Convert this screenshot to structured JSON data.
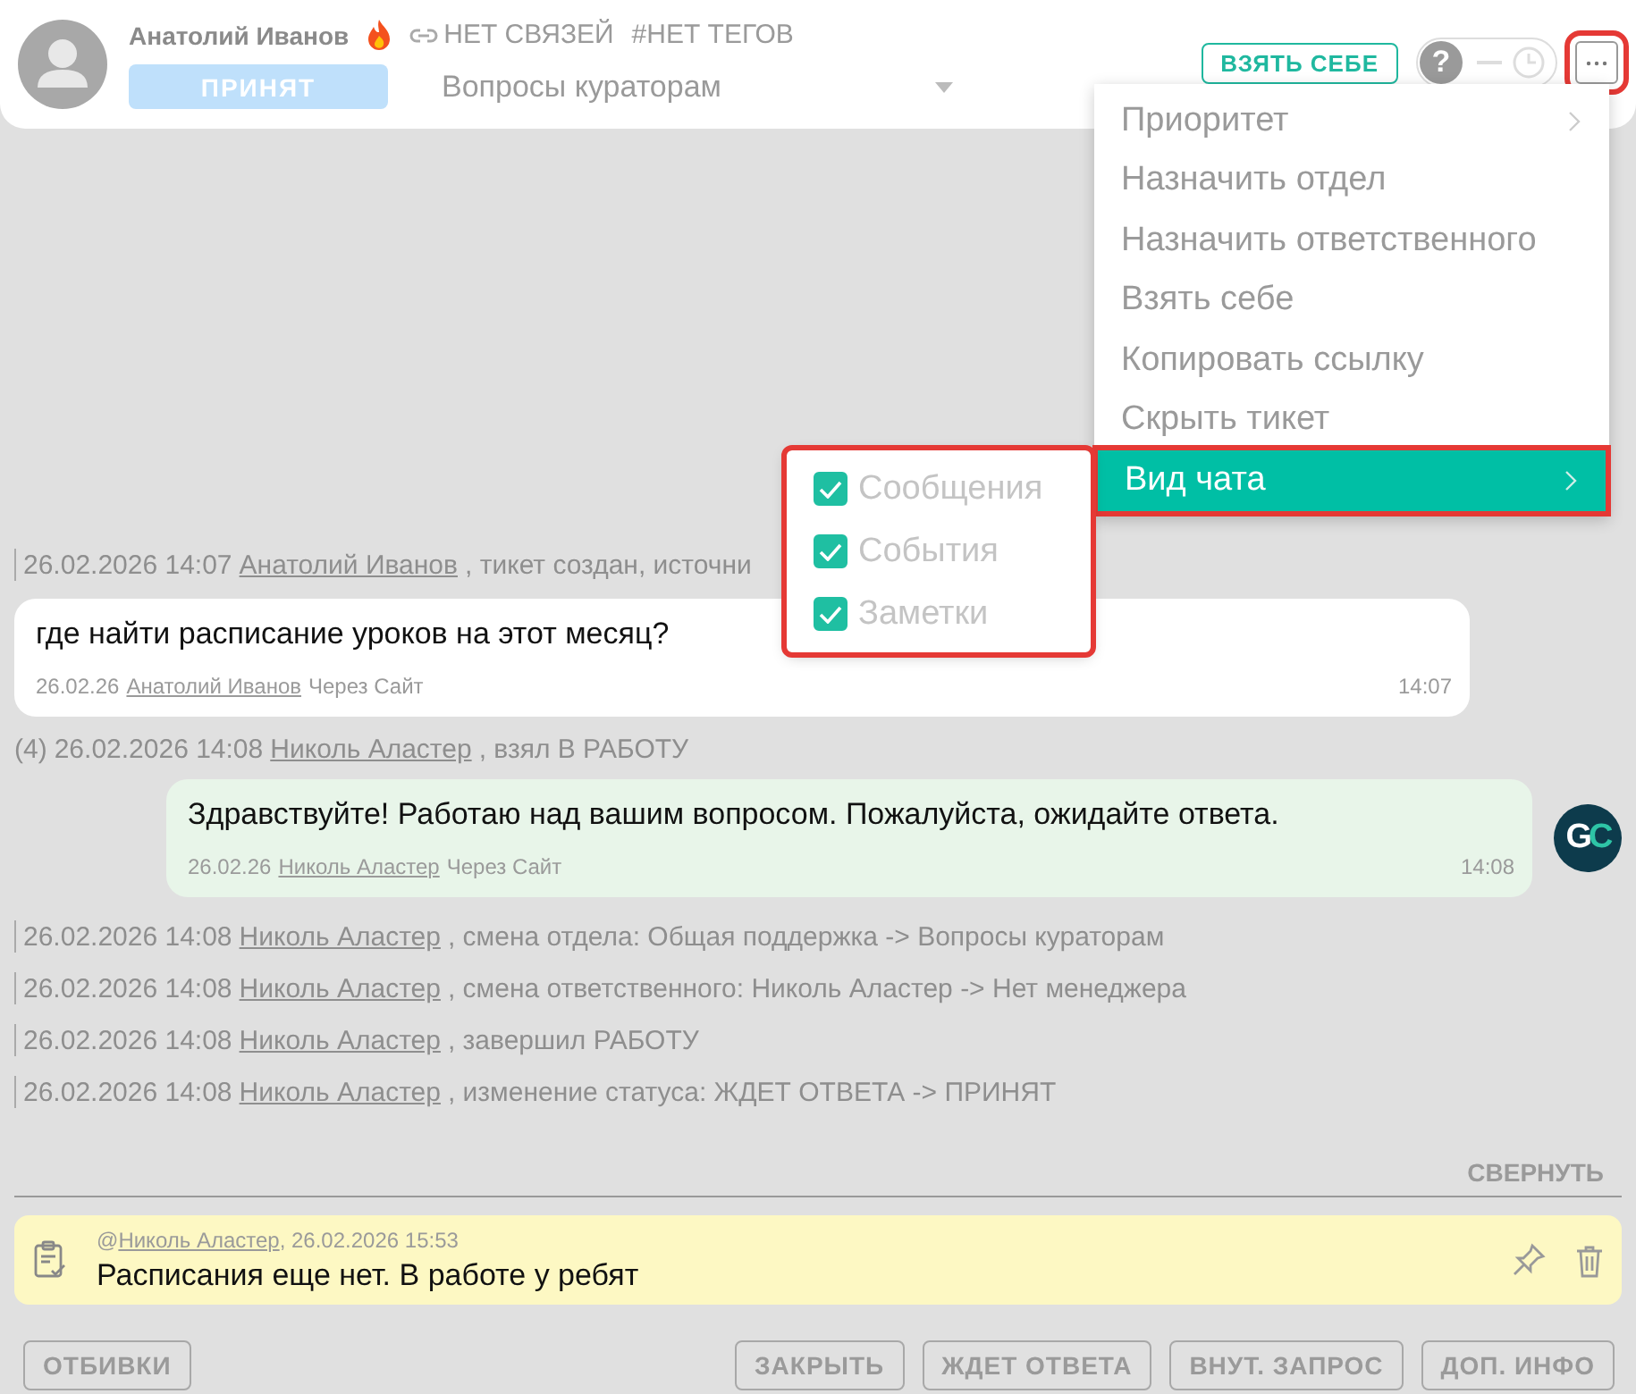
{
  "header": {
    "name": "Анатолий Иванов",
    "links": "НЕТ СВЯЗЕЙ",
    "tags": "#НЕТ ТЕГОВ",
    "status": "ПРИНЯТ",
    "department": "Вопросы кураторам",
    "take_button": "ВЗЯТЬ СЕБЕ",
    "help_label": "?"
  },
  "menu": {
    "items": [
      {
        "label": "Приоритет",
        "submenu": true,
        "selected": false
      },
      {
        "label": "Назначить отдел",
        "submenu": false,
        "selected": false
      },
      {
        "label": "Назначить ответственного",
        "submenu": false,
        "selected": false
      },
      {
        "label": "Взять себе",
        "submenu": false,
        "selected": false
      },
      {
        "label": "Копировать ссылку",
        "submenu": false,
        "selected": false
      },
      {
        "label": "Скрыть тикет",
        "submenu": false,
        "selected": false
      },
      {
        "label": "Вид чата",
        "submenu": true,
        "selected": true
      }
    ]
  },
  "submenu": {
    "items": [
      {
        "label": "Сообщения",
        "checked": true
      },
      {
        "label": "События",
        "checked": true
      },
      {
        "label": "Заметки",
        "checked": true
      }
    ]
  },
  "feed": [
    {
      "kind": "event",
      "datetime": "26.02.2026 14:07",
      "author": "Анатолий Иванов",
      "text": ", тикет создан, источни"
    },
    {
      "kind": "incoming",
      "text": "где найти расписание уроков на этот месяц?",
      "date": "26.02.26",
      "author": "Анатолий Иванов",
      "via": "Через Сайт",
      "time": "14:07"
    },
    {
      "kind": "event",
      "count": "(4)",
      "datetime": "26.02.2026 14:08",
      "author": "Николь Аластер",
      "text": ", взял В РАБОТУ"
    },
    {
      "kind": "outgoing",
      "text": "Здравствуйте! Работаю над вашим вопросом. Пожалуйста, ожидайте ответа.",
      "date": "26.02.26",
      "author": "Николь Аластер",
      "via": "Через Сайт",
      "time": "14:08",
      "avatar": "GC"
    },
    {
      "kind": "event",
      "datetime": "26.02.2026 14:08",
      "author": "Николь Аластер",
      "text": ", смена отдела: Общая поддержка -> Вопросы кураторам"
    },
    {
      "kind": "event",
      "datetime": "26.02.2026 14:08",
      "author": "Николь Аластер",
      "text": ", смена ответственного: Николь Аластер -> Нет менеджера"
    },
    {
      "kind": "event",
      "datetime": "26.02.2026 14:08",
      "author": "Николь Аластер",
      "text": ", завершил РАБОТУ"
    },
    {
      "kind": "event",
      "datetime": "26.02.2026 14:08",
      "author": "Николь Аластер",
      "text": ", изменение статуса: ЖДЕТ ОТВЕТА -> ПРИНЯТ"
    }
  ],
  "collapse_button": "СВЕРНУТЬ",
  "note": {
    "mention": "@",
    "author": "Николь Аластер",
    "meta": ", 26.02.2026 15:53",
    "text": "Расписания еще нет. В работе у ребят"
  },
  "footer": {
    "left": [
      "ОТБИВКИ"
    ],
    "right": [
      "ЗАКРЫТЬ",
      "ЖДЕТ ОТВЕТА",
      "ВНУТ. ЗАПРОС",
      "ДОП. ИНФО"
    ]
  }
}
